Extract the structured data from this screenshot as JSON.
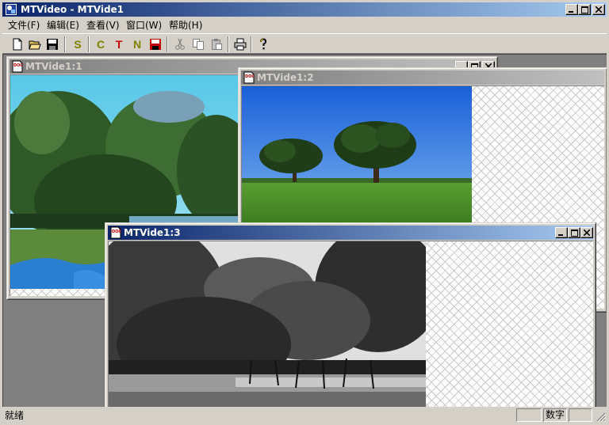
{
  "app": {
    "title": "MTVideo - MTVide1",
    "icon": "mtvideo-app-icon"
  },
  "menu": [
    "文件(F)",
    "编辑(E)",
    "查看(V)",
    "窗口(W)",
    "帮助(H)"
  ],
  "toolbar": {
    "buttons": [
      {
        "name": "new-document-icon"
      },
      {
        "name": "open-folder-icon"
      },
      {
        "name": "save-disk-icon"
      },
      {
        "label": "S",
        "color": "#808000"
      },
      {
        "label": "C",
        "color": "#808000"
      },
      {
        "label": "T",
        "color": "#c00000"
      },
      {
        "label": "N",
        "color": "#808000"
      },
      {
        "name": "save-red-disk-icon"
      },
      {
        "name": "cut-scissors-icon"
      },
      {
        "name": "copy-icon"
      },
      {
        "name": "paste-icon"
      },
      {
        "name": "print-icon"
      },
      {
        "name": "help-question-icon"
      }
    ]
  },
  "windows": [
    {
      "title": "MTVide1:1",
      "state": "inactive",
      "frame": "color-mangrove"
    },
    {
      "title": "MTVide1:2",
      "state": "inactive",
      "frame": "color-meadow-trees"
    },
    {
      "title": "MTVide1:3",
      "state": "active",
      "frame": "grayscale-mangrove"
    }
  ],
  "status": {
    "text": "就绪",
    "panes": [
      "",
      "数字",
      ""
    ]
  },
  "colors": {
    "active_title_start": "#0a246a",
    "active_title_end": "#a6caf0",
    "inactive_title_start": "#808080",
    "face": "#d4d0c8",
    "mdi_background": "#808080"
  }
}
